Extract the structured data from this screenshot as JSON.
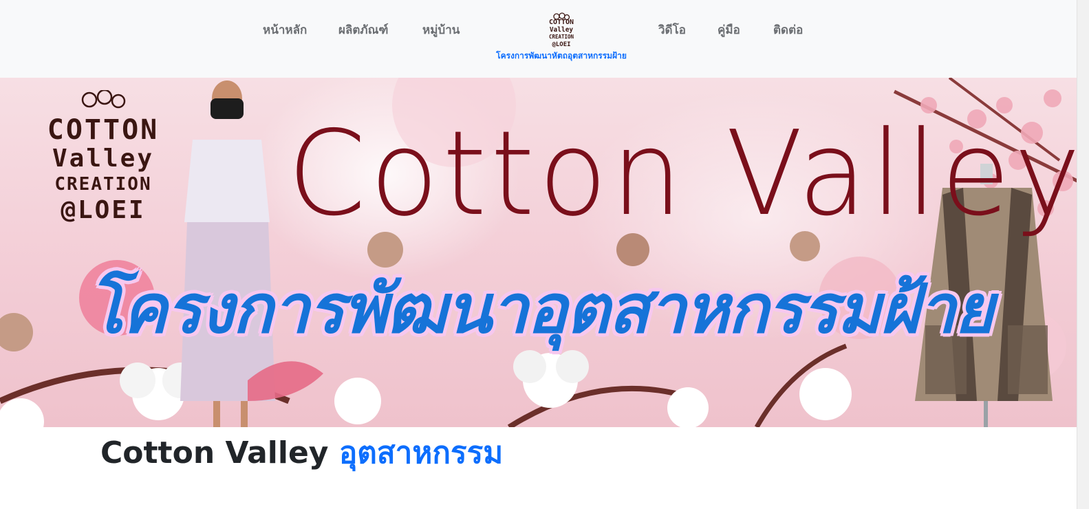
{
  "nav": {
    "items": [
      {
        "label": "หน้าหลัก"
      },
      {
        "label": "ผลิตภัณฑ์"
      },
      {
        "label": "หมู่บ้าน"
      },
      {
        "label": "วิดีโอ"
      },
      {
        "label": "คู่มือ"
      },
      {
        "label": "ติดต่อ"
      }
    ],
    "brand": {
      "logo_lines": [
        "COTTON",
        "Valley",
        "CREATION",
        "@LOEI"
      ],
      "caption": "โครงการพัฒนาหัตถอุตสาหกรรมฝ้าย"
    }
  },
  "hero": {
    "logo_lines": [
      "COTTON",
      "Valley",
      "CREATION",
      "@LOEI"
    ],
    "title": "Cotton Valley",
    "subtitle": "โครงการพัฒนาอุตสาหกรรมฝ้าย"
  },
  "content": {
    "heading_main": "Cotton Valley",
    "heading_accent": "อุตสาหกรรม"
  },
  "colors": {
    "nav_bg": "#f8f9fa",
    "nav_text": "#6c6f73",
    "brand_blue": "#0d6efd",
    "title_maroon": "#7a0f1b",
    "thai_blue": "#1673d8",
    "logo_brown": "#3a1612"
  }
}
